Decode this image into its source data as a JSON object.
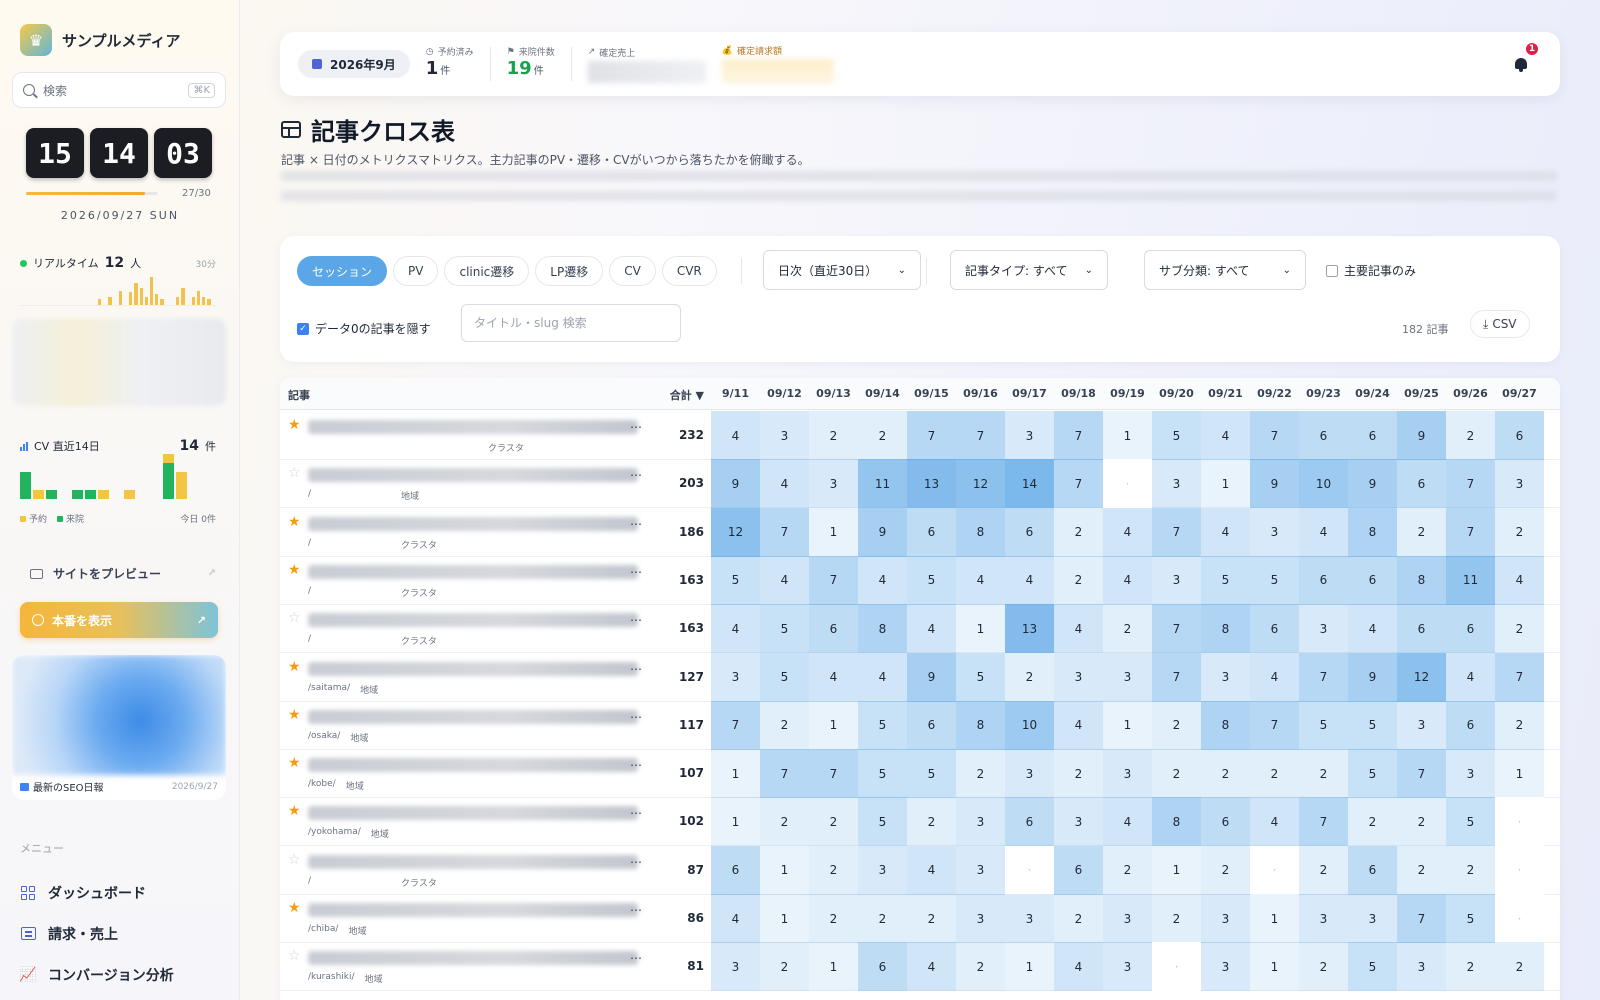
{
  "sidebar": {
    "brand": "サンプルメディア",
    "search_placeholder": "検索",
    "search_shortcut": "⌘K",
    "clock": {
      "h": "15",
      "m": "14",
      "s": "03"
    },
    "month_progress": {
      "label": "27/30",
      "fraction": 0.9
    },
    "date": "2026/09/27 SUN",
    "realtime": {
      "label": "リアルタイム",
      "count": "12",
      "unit": "人",
      "window": "30分",
      "bars": [
        0,
        0,
        0,
        0,
        0,
        0,
        0,
        0,
        0,
        0,
        0,
        0,
        0,
        0,
        0,
        20,
        0,
        30,
        0,
        50,
        0,
        45,
        80,
        60,
        30,
        100,
        40,
        20,
        0,
        0,
        30,
        60,
        0,
        30,
        50,
        30,
        20,
        0
      ]
    },
    "cv": {
      "label": "CV 直近14日",
      "total": "14",
      "unit": "件",
      "bars": [
        {
          "r": 0,
          "v": 3
        },
        {
          "r": 1,
          "v": 0
        },
        {
          "r": 0,
          "v": 1
        },
        {
          "r": 0,
          "v": 0
        },
        {
          "r": 0,
          "v": 1
        },
        {
          "r": 0,
          "v": 1
        },
        {
          "r": 1,
          "v": 0
        },
        {
          "r": 0,
          "v": 0
        },
        {
          "r": 1,
          "v": 0
        },
        {
          "r": 0,
          "v": 0
        },
        {
          "r": 0,
          "v": 0
        },
        {
          "r": 1,
          "v": 4
        },
        {
          "r": 3,
          "v": 0
        },
        {
          "r": 0,
          "v": 0
        }
      ],
      "legend_reserved": "予約",
      "legend_visit": "来院",
      "today": "今日 0件"
    },
    "preview_label": "サイトをプレビュー",
    "prod_label": "本番を表示",
    "seo": {
      "title": "最新のSEO日報",
      "date": "2026/9/27"
    },
    "menu_header": "メニュー",
    "menu": [
      {
        "label": "ダッシュボード",
        "icon": "grid-icon"
      },
      {
        "label": "請求・売上",
        "icon": "invoice-icon"
      },
      {
        "label": "コンバージョン分析",
        "icon": "chart-line-icon"
      }
    ]
  },
  "header": {
    "month": "2026年9月",
    "reserved": {
      "label": "予約済み",
      "value": "1",
      "unit": "件"
    },
    "visits": {
      "label": "来院件数",
      "value": "19",
      "unit": "件"
    },
    "sales": {
      "label": "確定売上"
    },
    "billing": {
      "label": "確定請求額"
    },
    "notifications": "1"
  },
  "page": {
    "title": "記事クロス表",
    "subtitle": "記事 × 日付のメトリクスマトリクス。主力記事のPV・遷移・CVがいつから落ちたかを俯瞰する。"
  },
  "filters": {
    "metrics": [
      "セッション",
      "PV",
      "clinic遷移",
      "LP遷移",
      "CV",
      "CVR"
    ],
    "active_metric": 0,
    "period": "日次（直近30日）",
    "type": "記事タイプ: すべて",
    "subcat": "サブ分類: すべて",
    "main_only": "主要記事のみ",
    "hide_zero": "データ0の記事を隠す",
    "search_placeholder": "タイトル・slug 検索",
    "count": "182 記事",
    "csv": "CSV"
  },
  "table": {
    "col_article": "記事",
    "col_total": "合計 ▼",
    "dates": [
      "9/11",
      "09/12",
      "09/13",
      "09/14",
      "09/15",
      "09/16",
      "09/17",
      "09/18",
      "09/19",
      "09/20",
      "09/21",
      "09/22",
      "09/23",
      "09/24",
      "09/25",
      "09/26",
      "09/27"
    ],
    "rows": [
      {
        "star": true,
        "slug": "",
        "cat": "クラスタ",
        "total": "232",
        "v": [
          4,
          3,
          2,
          2,
          7,
          7,
          3,
          7,
          1,
          5,
          4,
          7,
          6,
          6,
          9,
          2,
          6
        ]
      },
      {
        "star": false,
        "slug": "/",
        "cat": "地域",
        "total": "203",
        "v": [
          9,
          4,
          3,
          11,
          13,
          12,
          14,
          7,
          null,
          3,
          1,
          9,
          10,
          9,
          6,
          7,
          3
        ]
      },
      {
        "star": true,
        "slug": "/",
        "cat": "クラスタ",
        "total": "186",
        "v": [
          12,
          7,
          1,
          9,
          6,
          8,
          6,
          2,
          4,
          7,
          4,
          3,
          4,
          8,
          2,
          7,
          2
        ]
      },
      {
        "star": true,
        "slug": "/",
        "cat": "クラスタ",
        "total": "163",
        "v": [
          5,
          4,
          7,
          4,
          5,
          4,
          4,
          2,
          4,
          3,
          5,
          5,
          6,
          6,
          8,
          11,
          4
        ]
      },
      {
        "star": false,
        "slug": "/",
        "cat": "クラスタ",
        "total": "163",
        "v": [
          4,
          5,
          6,
          8,
          4,
          1,
          13,
          4,
          2,
          7,
          8,
          6,
          3,
          4,
          6,
          6,
          2
        ]
      },
      {
        "star": true,
        "slug": "/saitama/",
        "cat": "地域",
        "total": "127",
        "v": [
          3,
          5,
          4,
          4,
          9,
          5,
          2,
          3,
          3,
          7,
          3,
          4,
          7,
          9,
          12,
          4,
          7
        ]
      },
      {
        "star": true,
        "slug": "/osaka/",
        "cat": "地域",
        "total": "117",
        "v": [
          7,
          2,
          1,
          5,
          6,
          8,
          10,
          4,
          1,
          2,
          8,
          7,
          5,
          5,
          3,
          6,
          2
        ]
      },
      {
        "star": true,
        "slug": "/kobe/",
        "cat": "地域",
        "total": "107",
        "v": [
          1,
          7,
          7,
          5,
          5,
          2,
          3,
          2,
          3,
          2,
          2,
          2,
          2,
          5,
          7,
          3,
          1
        ]
      },
      {
        "star": true,
        "slug": "/yokohama/",
        "cat": "地域",
        "total": "102",
        "v": [
          1,
          2,
          2,
          5,
          2,
          3,
          6,
          3,
          4,
          8,
          6,
          4,
          7,
          2,
          2,
          5,
          null
        ]
      },
      {
        "star": false,
        "slug": "/",
        "cat": "クラスタ",
        "total": "87",
        "v": [
          6,
          1,
          2,
          3,
          4,
          3,
          null,
          6,
          2,
          1,
          2,
          null,
          2,
          6,
          2,
          2,
          null
        ]
      },
      {
        "star": true,
        "slug": "/chiba/",
        "cat": "地域",
        "total": "86",
        "v": [
          4,
          1,
          2,
          2,
          2,
          3,
          3,
          2,
          3,
          2,
          3,
          1,
          3,
          3,
          7,
          5,
          null
        ]
      },
      {
        "star": false,
        "slug": "/kurashiki/",
        "cat": "地域",
        "total": "81",
        "v": [
          3,
          2,
          1,
          6,
          4,
          2,
          1,
          4,
          3,
          null,
          3,
          1,
          2,
          5,
          3,
          2,
          2
        ]
      }
    ],
    "heat_color": "#5aa6e6",
    "empty_mark": "·"
  }
}
